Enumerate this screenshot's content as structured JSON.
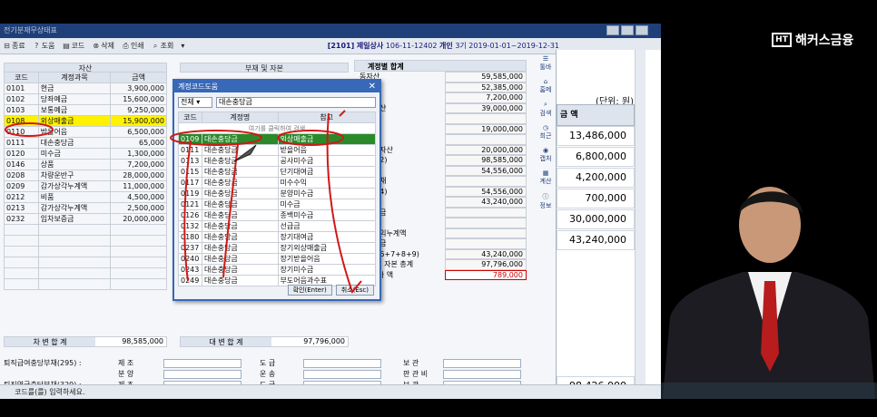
{
  "window": {
    "title": "전기분재무상태표",
    "company_code": "[2101]",
    "company_name": "제일상사",
    "biz_no": "106-11-12402",
    "type": "개인",
    "period": "3기 2019-01-01~2019-12-31"
  },
  "toolbar": {
    "items": [
      {
        "icon": "close-icon",
        "glyph": "⊟",
        "label": "종료"
      },
      {
        "icon": "help-icon",
        "glyph": "?",
        "label": "도움"
      },
      {
        "icon": "code-icon",
        "glyph": "▤",
        "label": "코드"
      },
      {
        "icon": "delete-icon",
        "glyph": "⊗",
        "label": "삭제"
      },
      {
        "icon": "print-icon",
        "glyph": "⎙",
        "label": "인쇄"
      },
      {
        "icon": "search-icon",
        "glyph": "⌕",
        "label": "조회"
      }
    ]
  },
  "assets": {
    "section_title": "자산",
    "headers": [
      "코드",
      "계정과목",
      "금액"
    ],
    "rows": [
      {
        "code": "0101",
        "name": "현금",
        "amount": "3,900,000"
      },
      {
        "code": "0102",
        "name": "당좌예금",
        "amount": "15,600,000"
      },
      {
        "code": "0103",
        "name": "보통예금",
        "amount": "9,250,000"
      },
      {
        "code": "0108",
        "name": "외상매출금",
        "amount": "15,900,000"
      },
      {
        "code": "0110",
        "name": "받을어음",
        "amount": "6,500,000"
      },
      {
        "code": "0111",
        "name": "대손충당금",
        "amount": "65,000"
      },
      {
        "code": "0120",
        "name": "미수금",
        "amount": "1,300,000"
      },
      {
        "code": "0146",
        "name": "상품",
        "amount": "7,200,000"
      },
      {
        "code": "0208",
        "name": "차량운반구",
        "amount": "28,000,000"
      },
      {
        "code": "0209",
        "name": "감가상각누계액",
        "amount": "11,000,000"
      },
      {
        "code": "0212",
        "name": "비품",
        "amount": "4,500,000"
      },
      {
        "code": "0213",
        "name": "감가상각누계액",
        "amount": "2,500,000"
      },
      {
        "code": "0232",
        "name": "임차보증금",
        "amount": "20,000,000"
      }
    ],
    "total_label": "차 변 합 계",
    "total_value": "98,585,000"
  },
  "liabilities": {
    "section_title": "부채 및 자본",
    "total_label": "대 변 합 계",
    "total_value": "97,796,000"
  },
  "summary": {
    "title": "계정별 합계",
    "rows": [
      {
        "label": "동자산",
        "value": "59,585,000"
      },
      {
        "label": "좌자산",
        "value": "52,385,000"
      },
      {
        "label": "고자산",
        "value": "7,200,000"
      },
      {
        "label": "유동자산",
        "value": "39,000,000"
      },
      {
        "label": "자자산",
        "value": ""
      },
      {
        "label": "형자산",
        "value": "19,000,000"
      },
      {
        "label": "형자산",
        "value": ""
      },
      {
        "label": "비유동자산",
        "value": "20,000,000"
      },
      {
        "label": "계(1+2)",
        "value": "98,585,000"
      },
      {
        "label": "동부채",
        "value": "54,556,000"
      },
      {
        "label": "유동부채",
        "value": ""
      },
      {
        "label": "계(3+4)",
        "value": "54,556,000"
      },
      {
        "label": "본금",
        "value": "43,240,000"
      },
      {
        "label": "본잉여금",
        "value": ""
      },
      {
        "label": "본조정",
        "value": ""
      },
      {
        "label": "포괄손익누계액",
        "value": ""
      },
      {
        "label": "익잉여금",
        "value": ""
      },
      {
        "label": "계(5+6+7+8+9)",
        "value": "43,240,000"
      },
      {
        "label": "부채 및 자본 총계",
        "value": "97,796,000"
      },
      {
        "label": "대 차 차 액",
        "value": "789,000",
        "alert": true
      }
    ]
  },
  "sidenav": [
    {
      "icon": "menu-icon",
      "glyph": "☰",
      "label": "툴바"
    },
    {
      "icon": "home-icon",
      "glyph": "⌂",
      "label": "홈메"
    },
    {
      "icon": "search-icon",
      "glyph": "⌕",
      "label": "검색"
    },
    {
      "icon": "clock-icon",
      "glyph": "◷",
      "label": "최근"
    },
    {
      "icon": "camera-icon",
      "glyph": "◉",
      "label": "캡처"
    },
    {
      "icon": "calculator-icon",
      "glyph": "▦",
      "label": "계산"
    },
    {
      "icon": "info-icon",
      "glyph": "ⓘ",
      "label": "정보"
    }
  ],
  "right_panel": {
    "unit": "(단위: 원)",
    "column_header": "금 액",
    "values": [
      "13,486,000",
      "6,800,000",
      "4,200,000",
      "700,000",
      "30,000,000",
      "43,240,000"
    ],
    "bottom_value": "98,426,000"
  },
  "bottom_form": {
    "row1_label": "퇴직급여충당부채(295) :",
    "row2_label": "퇴직연금충당부채(329) :",
    "col_a": [
      "제 조",
      "분 양"
    ],
    "col_b": [
      "도 급",
      "운 송"
    ],
    "col_c": [
      "보 관",
      "판 관 비"
    ]
  },
  "status": {
    "message": "코드를(를) 입력하세요."
  },
  "dialog": {
    "title": "계정코드도움",
    "filter_option": "전체",
    "search_value": "대손충당금",
    "headers": [
      "코드",
      "계정명",
      "참고"
    ],
    "hint": "여기를 클릭하여 검색",
    "rows": [
      {
        "code": "0109",
        "name": "대손충당금",
        "note": "외상매출금",
        "selected": true
      },
      {
        "code": "0111",
        "name": "대손충당금",
        "note": "받을어음"
      },
      {
        "code": "0113",
        "name": "대손충당금",
        "note": "공사미수금"
      },
      {
        "code": "0115",
        "name": "대손충당금",
        "note": "단기대여금"
      },
      {
        "code": "0117",
        "name": "대손충당금",
        "note": "미수수익"
      },
      {
        "code": "0119",
        "name": "대손충당금",
        "note": "분양미수금"
      },
      {
        "code": "0121",
        "name": "대손충당금",
        "note": "미수금"
      },
      {
        "code": "0126",
        "name": "대손충당금",
        "note": "종백미수금"
      },
      {
        "code": "0132",
        "name": "대손충당금",
        "note": "선급금"
      },
      {
        "code": "0180",
        "name": "대손충당금",
        "note": "장기대여금"
      },
      {
        "code": "0237",
        "name": "대손충당금",
        "note": "장기외상매출금"
      },
      {
        "code": "0240",
        "name": "대손충당금",
        "note": "장기받을어음"
      },
      {
        "code": "0243",
        "name": "대손충당금",
        "note": "장기미수금"
      },
      {
        "code": "0249",
        "name": "대손충당금",
        "note": "부도어음과수표"
      }
    ],
    "ok_label": "확인(Enter)",
    "cancel_label": "취소(Esc)"
  },
  "branding": {
    "logo_mark": "HT",
    "logo_text": "해커스금융"
  }
}
